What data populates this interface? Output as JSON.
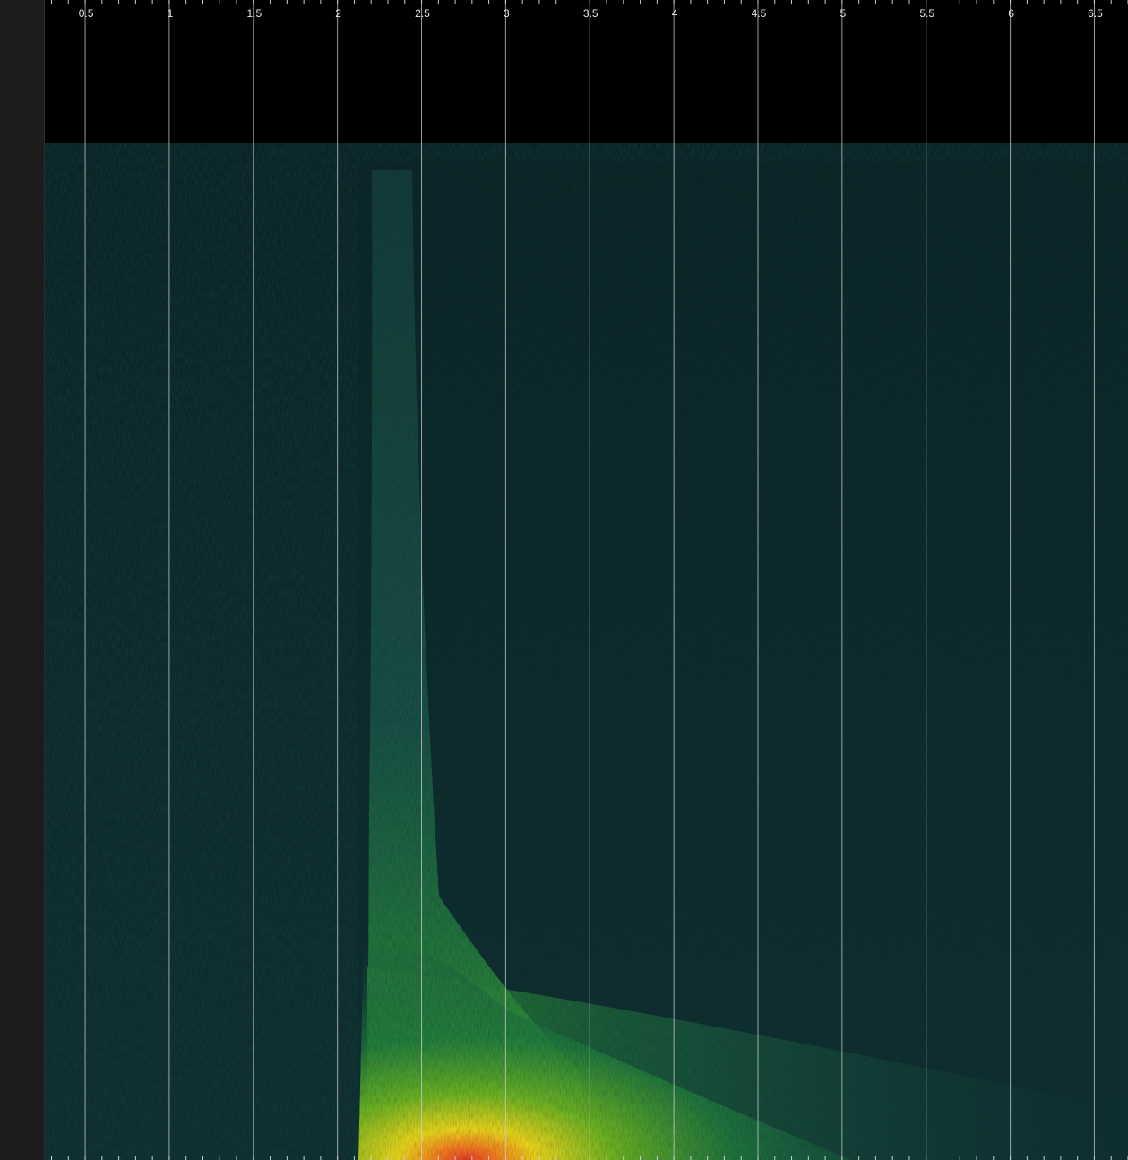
{
  "chart_data": {
    "type": "heatmap",
    "title": "",
    "xlabel": "",
    "ylabel": "",
    "x_ticks": [
      "0.5",
      "1",
      "1.5",
      "2",
      "2.5",
      "3",
      "3.5",
      "4",
      "4.5",
      "5",
      "5.5",
      "6",
      "6.5"
    ],
    "x_tick_values": [
      0.5,
      1,
      1.5,
      2,
      2.5,
      3,
      3.5,
      4,
      4.5,
      5,
      5.5,
      6,
      6.5
    ],
    "x_minor_step": 0.1,
    "xlim": [
      0.26,
      6.7
    ],
    "ylim_fraction": [
      0,
      1
    ],
    "grid": true,
    "colormap": [
      "#000000",
      "#0e2a2c",
      "#154a45",
      "#1f7a3e",
      "#6ab023",
      "#e8d31c",
      "#f07020",
      "#e03a2a"
    ],
    "onset_x": 2.1,
    "band": {
      "x_start": 2.2,
      "x_end": 2.5
    },
    "intensity_description": "low-frequency energy peaks just after onset (~2.2) and decays to the right"
  },
  "colors": {
    "background": "#000000",
    "gutter": "#1c1c1c",
    "grid": "#cfcfcf",
    "tick_text": "#e6e6e6"
  }
}
